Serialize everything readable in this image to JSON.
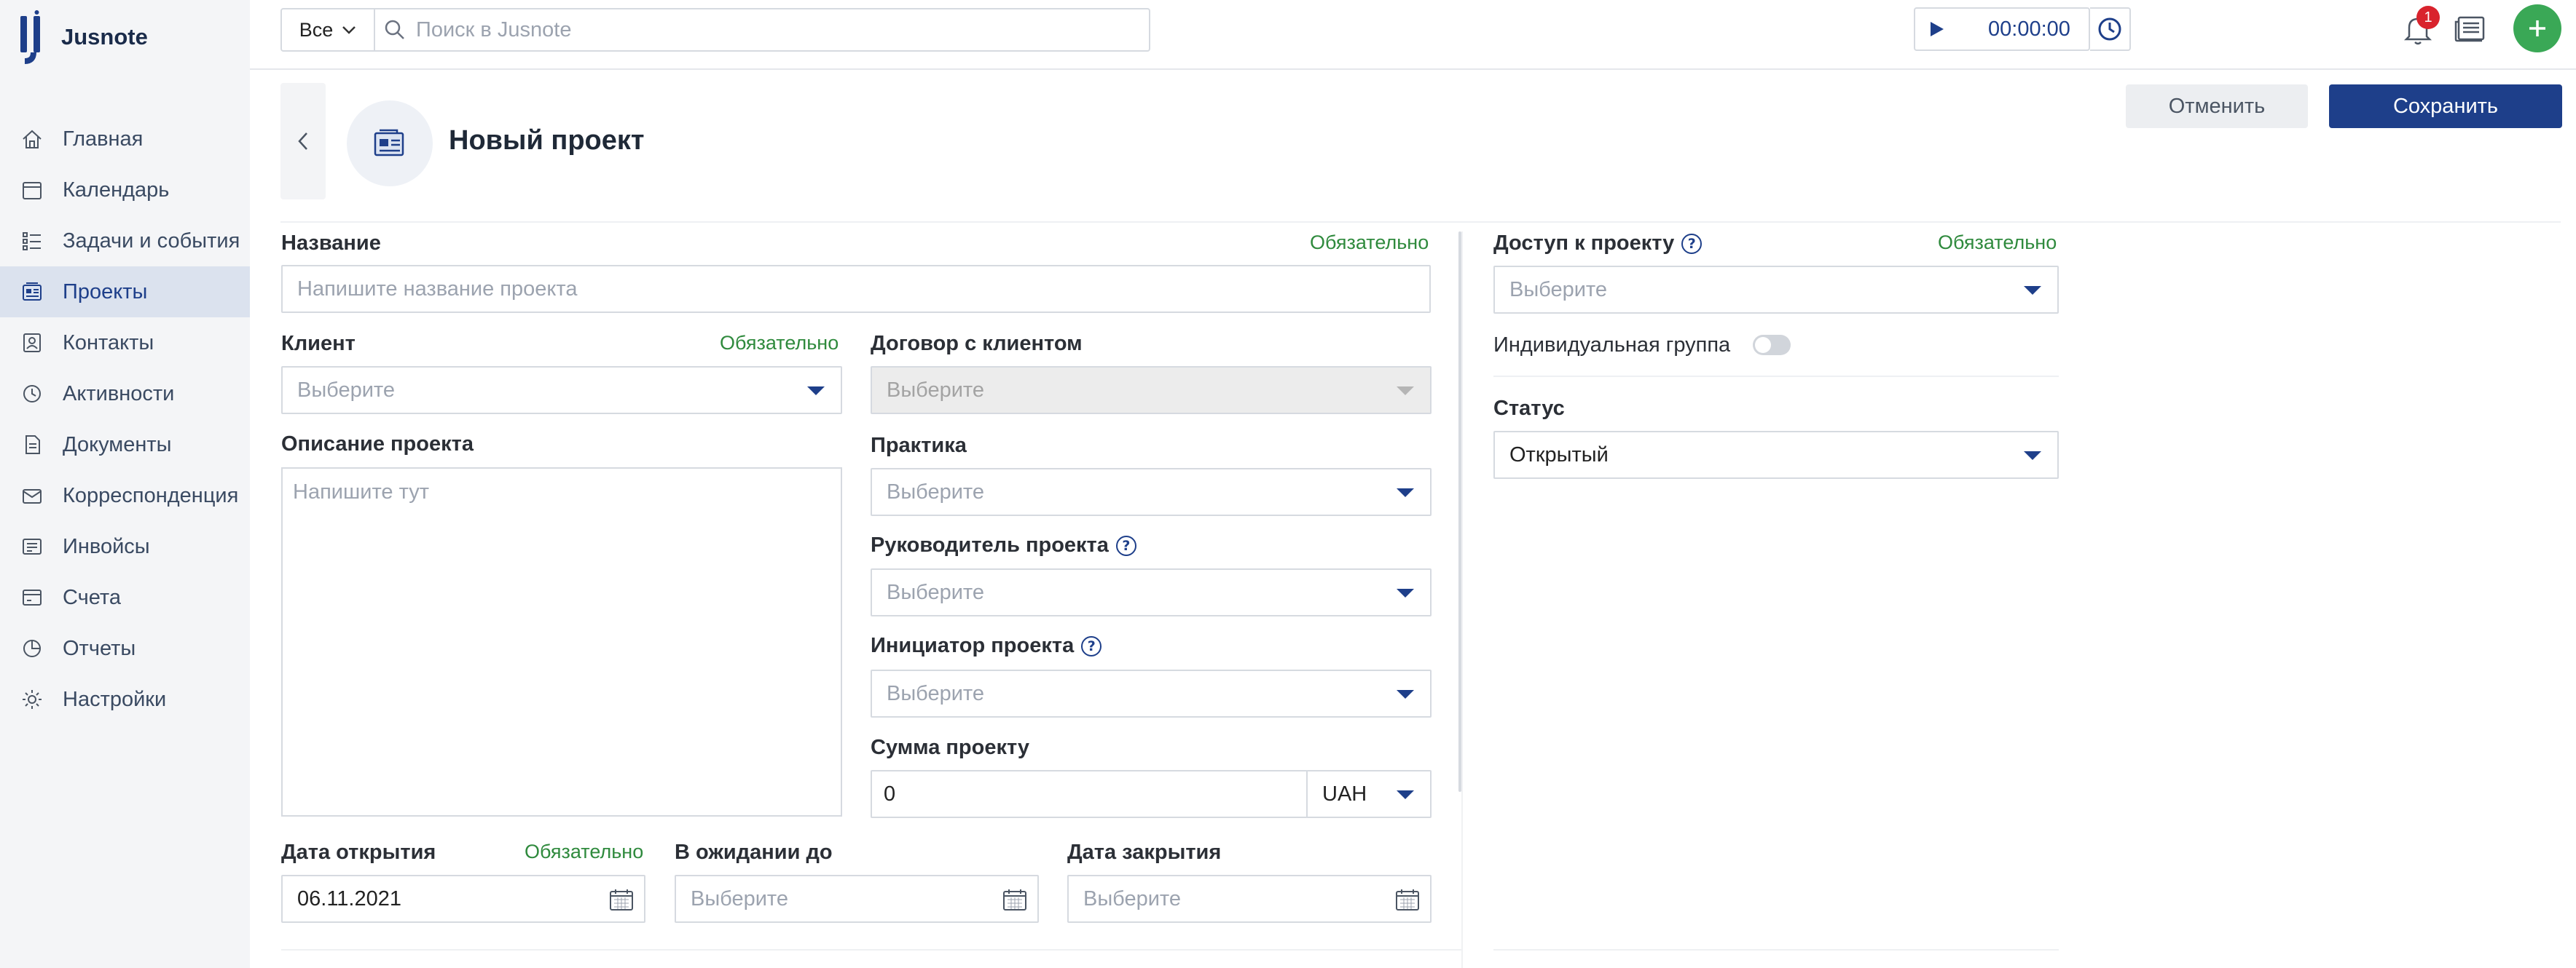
{
  "app": {
    "name": "Jusnote"
  },
  "sidebar": {
    "items": [
      {
        "label": "Главная",
        "icon": "home-icon"
      },
      {
        "label": "Календарь",
        "icon": "calendar-icon"
      },
      {
        "label": "Задачи и события",
        "icon": "tasks-icon"
      },
      {
        "label": "Проекты",
        "icon": "projects-icon",
        "active": true
      },
      {
        "label": "Контакты",
        "icon": "contacts-icon"
      },
      {
        "label": "Активности",
        "icon": "activity-icon"
      },
      {
        "label": "Документы",
        "icon": "documents-icon"
      },
      {
        "label": "Корреспонденция",
        "icon": "mail-icon"
      },
      {
        "label": "Инвойсы",
        "icon": "invoice-icon"
      },
      {
        "label": "Счета",
        "icon": "accounts-icon"
      },
      {
        "label": "Отчеты",
        "icon": "reports-icon"
      },
      {
        "label": "Настройки",
        "icon": "settings-icon"
      }
    ]
  },
  "topbar": {
    "scope": "Все",
    "search_placeholder": "Поиск в Jusnote",
    "timer": "00:00:00",
    "notifications_count": "1"
  },
  "header": {
    "title": "Новый проект",
    "cancel_label": "Отменить",
    "save_label": "Сохранить"
  },
  "form": {
    "required_text": "Обязательно",
    "name": {
      "label": "Название",
      "placeholder": "Напишите название проекта"
    },
    "client": {
      "label": "Клиент",
      "placeholder": "Выберите"
    },
    "contract": {
      "label": "Договор с клиентом",
      "placeholder": "Выберите"
    },
    "description": {
      "label": "Описание проекта",
      "placeholder": "Напишите тут"
    },
    "practice": {
      "label": "Практика",
      "placeholder": "Выберите"
    },
    "manager": {
      "label": "Руководитель проекта",
      "placeholder": "Выберите"
    },
    "initiator": {
      "label": "Инициатор проекта",
      "placeholder": "Выберите"
    },
    "amount": {
      "label": "Сумма проекту",
      "value": "0",
      "currency": "UAH"
    },
    "open_date": {
      "label": "Дата открытия",
      "value": "06.11.2021"
    },
    "pending_until": {
      "label": "В ожидании до",
      "placeholder": "Выберите"
    },
    "close_date": {
      "label": "Дата закрытия",
      "placeholder": "Выберите"
    },
    "access": {
      "label": "Доступ к проекту",
      "placeholder": "Выберите"
    },
    "individual_group": {
      "label": "Индивидуальная группа",
      "enabled": false
    },
    "status": {
      "label": "Статус",
      "value": "Открытый"
    }
  },
  "colors": {
    "accent": "#1e3f8a",
    "success": "#3aa856",
    "required": "#2f8a3d",
    "badge": "#d9232d"
  }
}
